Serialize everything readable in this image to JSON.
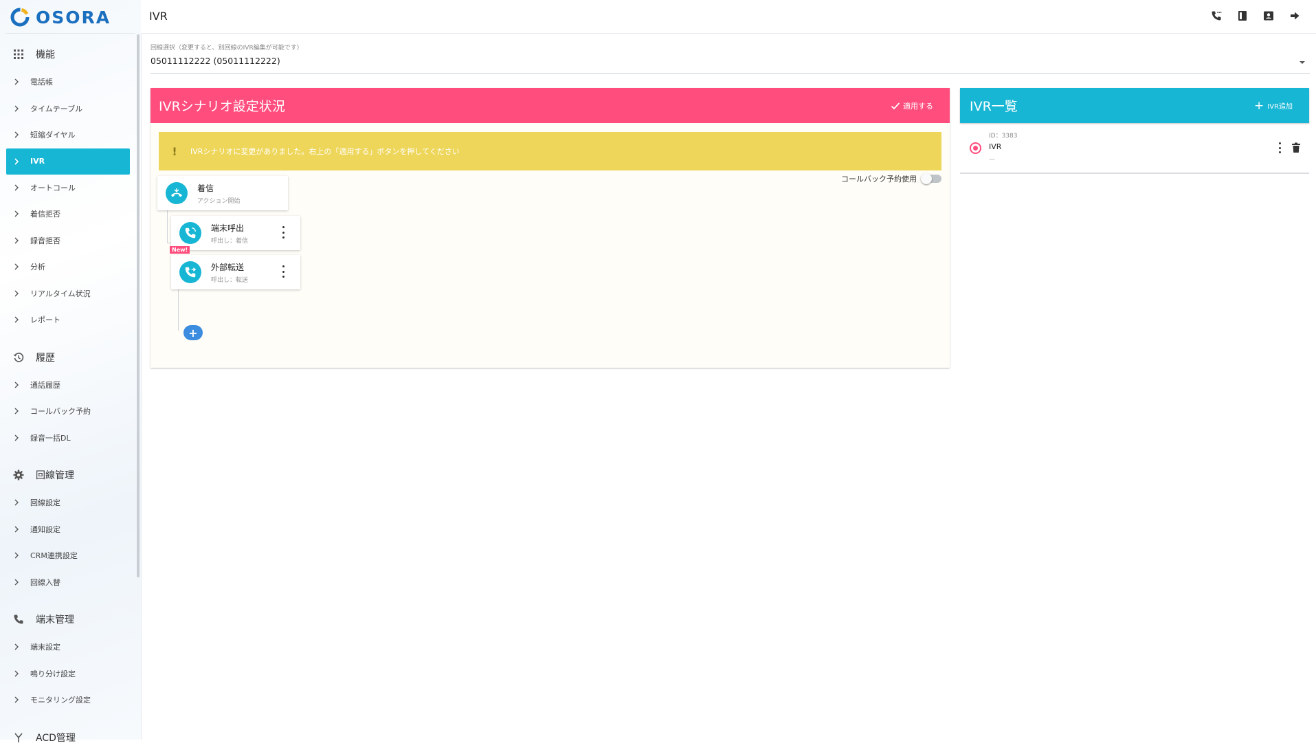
{
  "brand": {
    "name": "OSORA",
    "color": "#1a6fbf"
  },
  "header": {
    "title": "IVR",
    "icons": [
      "phone-settings-icon",
      "book-icon",
      "contact-card-icon",
      "logout-arrow-icon"
    ]
  },
  "sidebar": {
    "sections": [
      {
        "label": "機能",
        "icon": "grid-icon",
        "items": [
          "電話帳",
          "タイムテーブル",
          "短縮ダイヤル",
          "IVR",
          "オートコール",
          "着信拒否",
          "録音拒否",
          "分析",
          "リアルタイム状況",
          "レポート"
        ]
      },
      {
        "label": "履歴",
        "icon": "history-icon",
        "items": [
          "通話履歴",
          "コールバック予約",
          "録音一括DL"
        ]
      },
      {
        "label": "回線管理",
        "icon": "gear-icon",
        "items": [
          "回線設定",
          "通知設定",
          "CRM連携設定",
          "回線入替"
        ]
      },
      {
        "label": "端末管理",
        "icon": "phone-icon",
        "items": [
          "端末設定",
          "鳴り分け設定",
          "モニタリング設定"
        ]
      },
      {
        "label": "ACD管理",
        "icon": "fork-icon",
        "items": []
      }
    ],
    "active_item": "IVR"
  },
  "line_select": {
    "label": "回線選択（変更すると、別回線のIVR編集が可能です）",
    "value": "05011112222 (05011112222)"
  },
  "scenario": {
    "title": "IVRシナリオ設定状況",
    "apply_label": "適用する",
    "warning": "IVRシナリオに変更がありました。右上の「適用する」ボタンを押してください",
    "callback_label": "コールバック予約使用",
    "callback_enabled": false,
    "nodes": [
      {
        "title": "着信",
        "subtitle": "アクション開始",
        "icon": "incoming-call-icon"
      },
      {
        "title": "端末呼出",
        "subtitle": "呼出し：着信",
        "icon": "phone-ring-icon"
      },
      {
        "title": "外部転送",
        "subtitle": "呼出し：転送",
        "icon": "phone-forward-icon",
        "badge": "New!"
      }
    ],
    "add_label": "+"
  },
  "ivr_list": {
    "title": "IVR一覧",
    "add_label": "IVR追加",
    "items": [
      {
        "id": "ID：3383",
        "name": "IVR",
        "note": "—",
        "selected": true
      }
    ]
  },
  "colors": {
    "accent_cyan": "#17b6d4",
    "accent_pink": "#ff4d7e",
    "warning_yellow": "#eed65a"
  }
}
